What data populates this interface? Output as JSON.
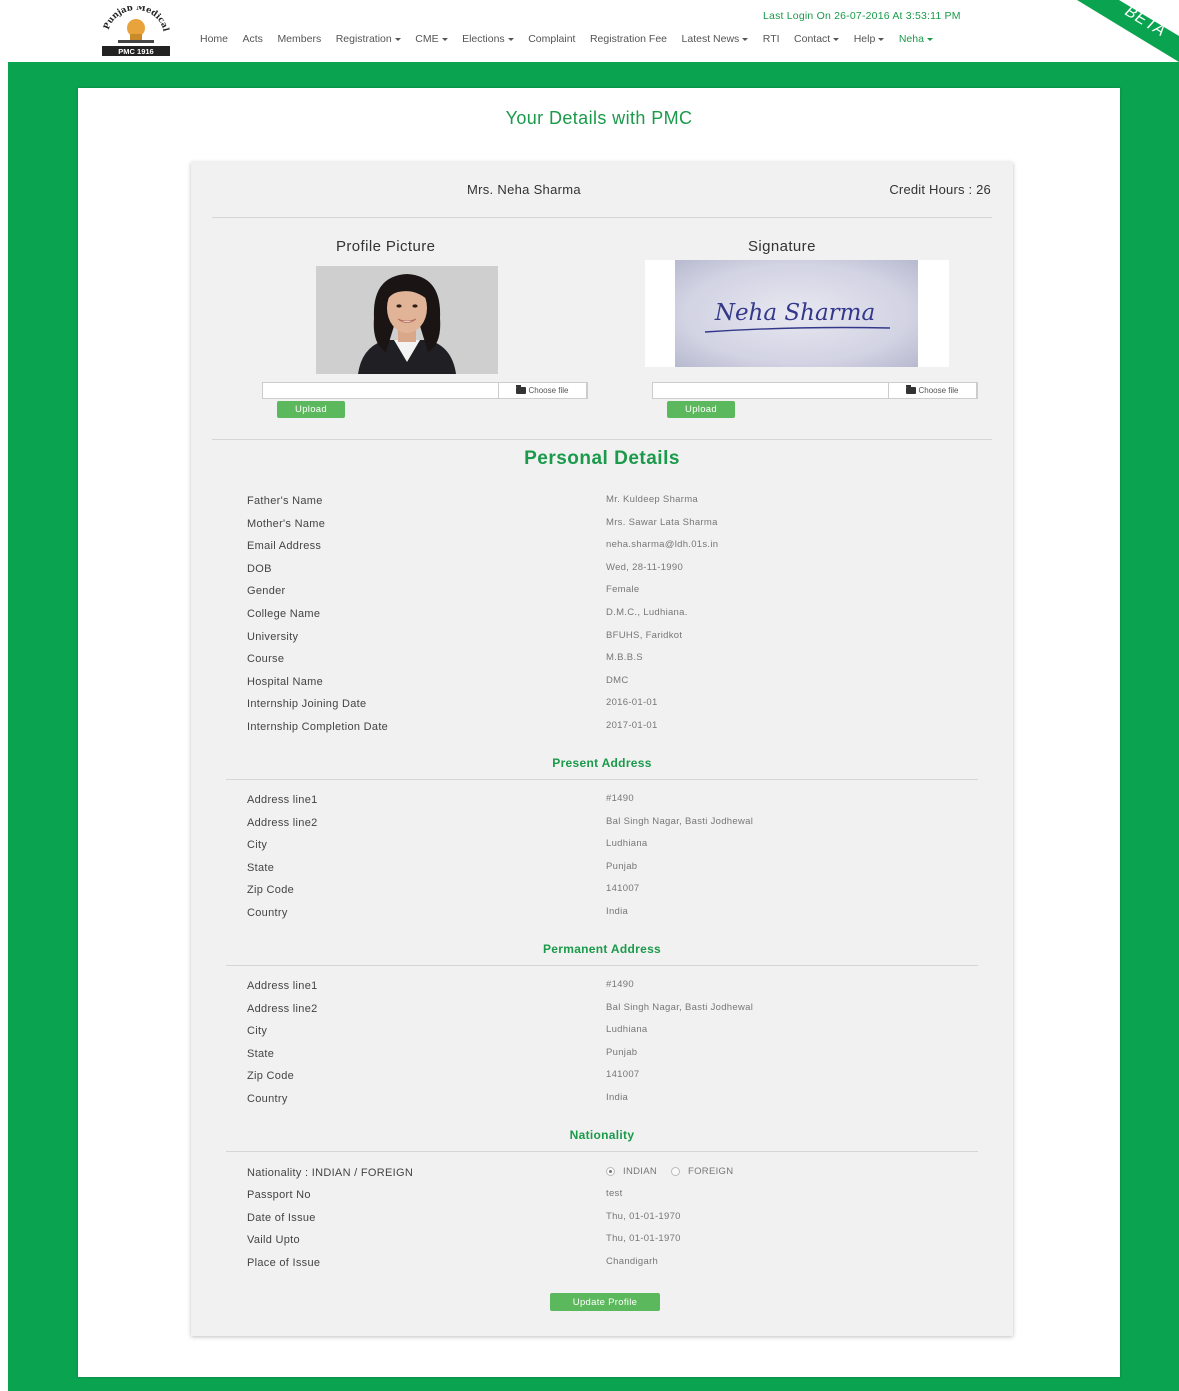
{
  "header": {
    "last_login": "Last Login On 26-07-2016 At 3:53:11 PM",
    "nav": [
      {
        "label": "Home",
        "dropdown": false
      },
      {
        "label": "Acts",
        "dropdown": false
      },
      {
        "label": "Members",
        "dropdown": false
      },
      {
        "label": "Registration",
        "dropdown": true
      },
      {
        "label": "CME",
        "dropdown": true
      },
      {
        "label": "Elections",
        "dropdown": true
      },
      {
        "label": "Complaint",
        "dropdown": false
      },
      {
        "label": "Registration Fee",
        "dropdown": false
      },
      {
        "label": "Latest News",
        "dropdown": true
      },
      {
        "label": "RTI",
        "dropdown": false
      },
      {
        "label": "Contact",
        "dropdown": true
      },
      {
        "label": "Help",
        "dropdown": true
      },
      {
        "label": "Neha",
        "dropdown": true,
        "active": true
      }
    ],
    "beta": "BETA",
    "logo_text": "Punjab Medical Council",
    "logo_band": "PMC 1916"
  },
  "page": {
    "title": "Your Details with PMC",
    "name": "Mrs. Neha Sharma",
    "credit_hours": "Credit Hours : 26",
    "profile_picture_label": "Profile Picture",
    "signature_label": "Signature",
    "signature_text": "Neha Sharma",
    "choose_file": "Choose file",
    "upload": "Upload",
    "update_profile": "Update Profile"
  },
  "personal": {
    "title": "Personal Details",
    "rows": [
      {
        "label": "Father's Name",
        "value": "Mr. Kuldeep Sharma"
      },
      {
        "label": "Mother's Name",
        "value": "Mrs. Sawar Lata Sharma"
      },
      {
        "label": "Email Address",
        "value": "neha.sharma@ldh.01s.in"
      },
      {
        "label": "DOB",
        "value": "Wed, 28-11-1990"
      },
      {
        "label": "Gender",
        "value": "Female"
      },
      {
        "label": "College Name",
        "value": "D.M.C., Ludhiana."
      },
      {
        "label": "University",
        "value": "BFUHS, Faridkot"
      },
      {
        "label": "Course",
        "value": "M.B.B.S"
      },
      {
        "label": "Hospital Name",
        "value": "DMC"
      },
      {
        "label": "Internship Joining Date",
        "value": "2016-01-01"
      },
      {
        "label": "Internship Completion Date",
        "value": "2017-01-01"
      }
    ]
  },
  "present": {
    "title": "Present Address",
    "rows": [
      {
        "label": "Address line1",
        "value": "#1490"
      },
      {
        "label": "Address line2",
        "value": "Bal Singh Nagar, Basti Jodhewal"
      },
      {
        "label": "City",
        "value": "Ludhiana"
      },
      {
        "label": "State",
        "value": "Punjab"
      },
      {
        "label": "Zip Code",
        "value": "141007"
      },
      {
        "label": "Country",
        "value": "India"
      }
    ]
  },
  "permanent": {
    "title": "Permanent Address",
    "rows": [
      {
        "label": "Address line1",
        "value": "#1490"
      },
      {
        "label": "Address line2",
        "value": "Bal Singh Nagar, Basti Jodhewal"
      },
      {
        "label": "City",
        "value": "Ludhiana"
      },
      {
        "label": "State",
        "value": "Punjab"
      },
      {
        "label": "Zip Code",
        "value": "141007"
      },
      {
        "label": "Country",
        "value": "India"
      }
    ]
  },
  "nationality": {
    "title": "Nationality",
    "nationality_label": "Nationality : INDIAN / FOREIGN",
    "options": [
      "INDIAN",
      "FOREIGN"
    ],
    "selected": "INDIAN",
    "rows": [
      {
        "label": "Passport No",
        "value": "test"
      },
      {
        "label": "Date of Issue",
        "value": "Thu, 01-01-1970"
      },
      {
        "label": "Vaild Upto",
        "value": "Thu, 01-01-1970"
      },
      {
        "label": "Place of Issue",
        "value": "Chandigarh"
      }
    ]
  },
  "colors": {
    "brand_green": "#0aa350",
    "text_green": "#1a9a4a",
    "button_green": "#5cb85c"
  },
  "icons": [
    "folder-icon",
    "caret-down-icon",
    "radio-icon"
  ]
}
